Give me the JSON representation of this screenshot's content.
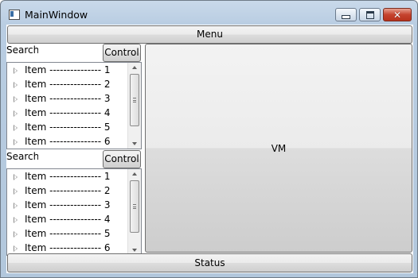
{
  "window": {
    "title": "MainWindow",
    "icons": {
      "app": "window-icon",
      "minimize": "minimize-icon",
      "maximize": "maximize-icon",
      "close": "close-icon"
    },
    "close_glyph": "✕"
  },
  "menu": {
    "label": "Menu"
  },
  "panels": [
    {
      "search_label": "Search",
      "search_value": "",
      "control_label": "Control",
      "items": [
        {
          "label": "Item --------------- 1"
        },
        {
          "label": "Item --------------- 2"
        },
        {
          "label": "Item --------------- 3"
        },
        {
          "label": "Item --------------- 4"
        },
        {
          "label": "Item --------------- 5"
        },
        {
          "label": "Item --------------- 6"
        }
      ]
    },
    {
      "search_label": "Search",
      "search_value": "",
      "control_label": "Control",
      "items": [
        {
          "label": "Item --------------- 1"
        },
        {
          "label": "Item --------------- 2"
        },
        {
          "label": "Item --------------- 3"
        },
        {
          "label": "Item --------------- 4"
        },
        {
          "label": "Item --------------- 5"
        },
        {
          "label": "Item --------------- 6"
        }
      ]
    }
  ],
  "main": {
    "label": "VM"
  },
  "status": {
    "label": "Status"
  }
}
